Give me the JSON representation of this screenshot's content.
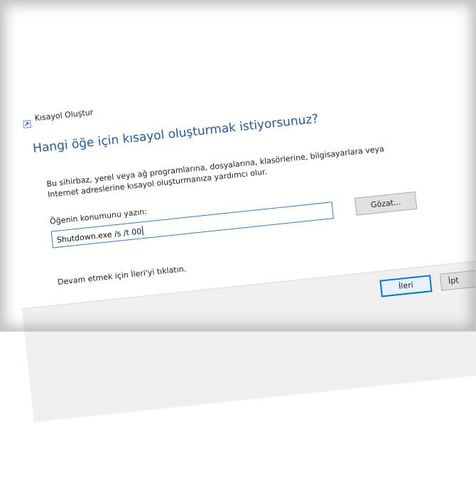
{
  "window": {
    "title": "Kısayol Oluştur"
  },
  "main": {
    "heading": "Hangi öğe için kısayol oluşturmak istiyorsunuz?",
    "description": "Bu sihirbaz, yerel veya ağ programlarına, dosyalarına, klasörlerine, bilgisayarlara veya Internet adreslerine kısayol oluşturmanıza yardımcı olur.",
    "location_label": "Öğenin konumunu yazın:",
    "location_value": "Shutdown.exe /s /t 00",
    "browse_label": "Gözat...",
    "hint": "Devam etmek için İleri'yi tıklatın."
  },
  "footer": {
    "next_label": "İleri",
    "cancel_label": "İpt"
  },
  "colors": {
    "heading": "#1c5aa6",
    "input_border": "#2b79d4",
    "primary_button_border": "#0078d7",
    "footer_bg": "#f0f0f0"
  }
}
